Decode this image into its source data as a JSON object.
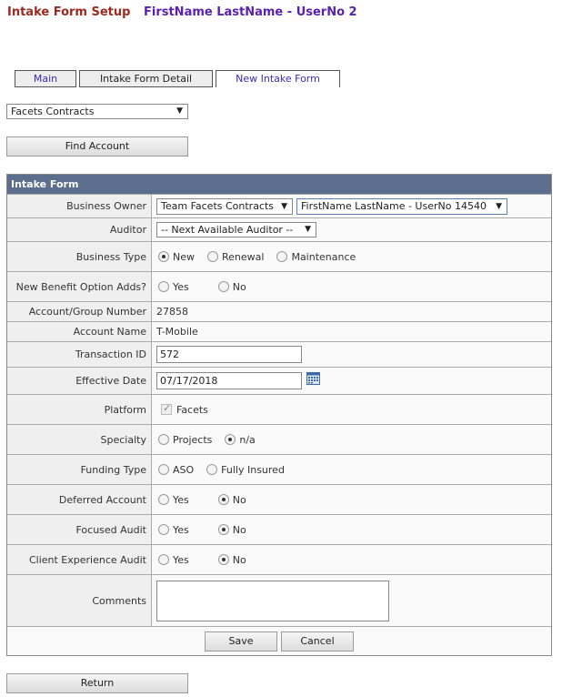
{
  "header": {
    "title": "Intake Form Setup",
    "user": "FirstName LastName - UserNo 2"
  },
  "tabs": [
    {
      "label": "Main"
    },
    {
      "label": "Intake Form Detail"
    },
    {
      "label": "New Intake Form",
      "active": true
    }
  ],
  "contracts_select": {
    "value": "Facets Contracts"
  },
  "find_account_label": "Find Account",
  "form": {
    "title": "Intake Form",
    "business_owner": {
      "label": "Business Owner",
      "team_value": "Team Facets Contracts",
      "user_value": "FirstName LastName - UserNo 14540"
    },
    "auditor": {
      "label": "Auditor",
      "value": "-- Next Available Auditor --"
    },
    "business_type": {
      "label": "Business Type",
      "options": [
        "New",
        "Renewal",
        "Maintenance"
      ],
      "selected": "New"
    },
    "new_benefit": {
      "label": "New Benefit Option Adds?",
      "options": [
        "Yes",
        "No"
      ],
      "selected": ""
    },
    "account_group_number": {
      "label": "Account/Group Number",
      "value": "27858"
    },
    "account_name": {
      "label": "Account Name",
      "value": "T-Mobile"
    },
    "transaction_id": {
      "label": "Transaction ID",
      "value": "572"
    },
    "effective_date": {
      "label": "Effective Date",
      "value": "07/17/2018"
    },
    "platform": {
      "label": "Platform",
      "option": "Facets",
      "checked": true
    },
    "specialty": {
      "label": "Specialty",
      "options": [
        "Projects",
        "n/a"
      ],
      "selected": "n/a"
    },
    "funding_type": {
      "label": "Funding Type",
      "options": [
        "ASO",
        "Fully Insured"
      ],
      "selected": ""
    },
    "deferred_account": {
      "label": "Deferred Account",
      "options": [
        "Yes",
        "No"
      ],
      "selected": "No"
    },
    "focused_audit": {
      "label": "Focused Audit",
      "options": [
        "Yes",
        "No"
      ],
      "selected": "No"
    },
    "client_experience_audit": {
      "label": "Client Experience Audit",
      "options": [
        "Yes",
        "No"
      ],
      "selected": "No"
    },
    "comments": {
      "label": "Comments",
      "value": ""
    },
    "save_label": "Save",
    "cancel_label": "Cancel"
  },
  "return_label": "Return",
  "colors": {
    "header_title": "#9b2a1e",
    "header_user": "#5a1fb3",
    "form_header_bg": "#5b6e8d"
  }
}
